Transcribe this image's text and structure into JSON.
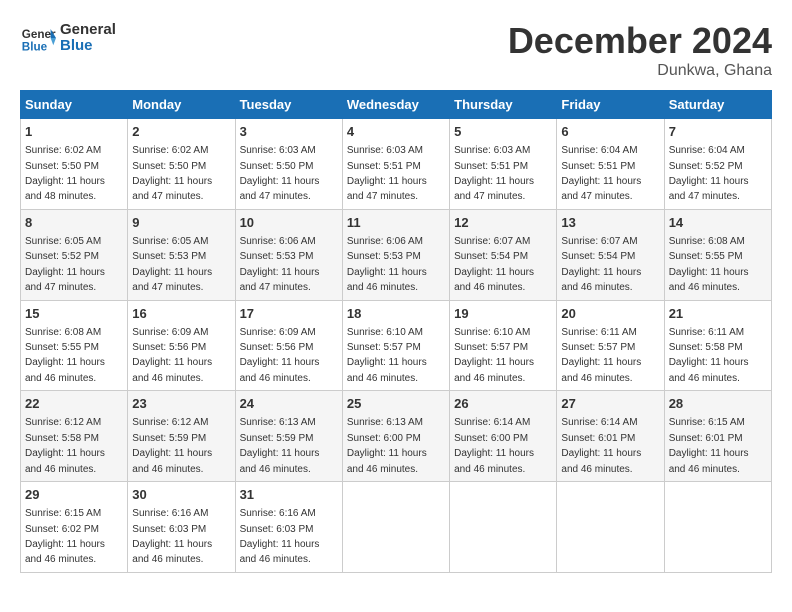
{
  "header": {
    "logo_line1": "General",
    "logo_line2": "Blue",
    "month": "December 2024",
    "location": "Dunkwa, Ghana"
  },
  "days_of_week": [
    "Sunday",
    "Monday",
    "Tuesday",
    "Wednesday",
    "Thursday",
    "Friday",
    "Saturday"
  ],
  "weeks": [
    [
      {
        "day": "1",
        "sunrise": "6:02 AM",
        "sunset": "5:50 PM",
        "daylight": "11 hours and 48 minutes."
      },
      {
        "day": "2",
        "sunrise": "6:02 AM",
        "sunset": "5:50 PM",
        "daylight": "11 hours and 47 minutes."
      },
      {
        "day": "3",
        "sunrise": "6:03 AM",
        "sunset": "5:50 PM",
        "daylight": "11 hours and 47 minutes."
      },
      {
        "day": "4",
        "sunrise": "6:03 AM",
        "sunset": "5:51 PM",
        "daylight": "11 hours and 47 minutes."
      },
      {
        "day": "5",
        "sunrise": "6:03 AM",
        "sunset": "5:51 PM",
        "daylight": "11 hours and 47 minutes."
      },
      {
        "day": "6",
        "sunrise": "6:04 AM",
        "sunset": "5:51 PM",
        "daylight": "11 hours and 47 minutes."
      },
      {
        "day": "7",
        "sunrise": "6:04 AM",
        "sunset": "5:52 PM",
        "daylight": "11 hours and 47 minutes."
      }
    ],
    [
      {
        "day": "8",
        "sunrise": "6:05 AM",
        "sunset": "5:52 PM",
        "daylight": "11 hours and 47 minutes."
      },
      {
        "day": "9",
        "sunrise": "6:05 AM",
        "sunset": "5:53 PM",
        "daylight": "11 hours and 47 minutes."
      },
      {
        "day": "10",
        "sunrise": "6:06 AM",
        "sunset": "5:53 PM",
        "daylight": "11 hours and 47 minutes."
      },
      {
        "day": "11",
        "sunrise": "6:06 AM",
        "sunset": "5:53 PM",
        "daylight": "11 hours and 46 minutes."
      },
      {
        "day": "12",
        "sunrise": "6:07 AM",
        "sunset": "5:54 PM",
        "daylight": "11 hours and 46 minutes."
      },
      {
        "day": "13",
        "sunrise": "6:07 AM",
        "sunset": "5:54 PM",
        "daylight": "11 hours and 46 minutes."
      },
      {
        "day": "14",
        "sunrise": "6:08 AM",
        "sunset": "5:55 PM",
        "daylight": "11 hours and 46 minutes."
      }
    ],
    [
      {
        "day": "15",
        "sunrise": "6:08 AM",
        "sunset": "5:55 PM",
        "daylight": "11 hours and 46 minutes."
      },
      {
        "day": "16",
        "sunrise": "6:09 AM",
        "sunset": "5:56 PM",
        "daylight": "11 hours and 46 minutes."
      },
      {
        "day": "17",
        "sunrise": "6:09 AM",
        "sunset": "5:56 PM",
        "daylight": "11 hours and 46 minutes."
      },
      {
        "day": "18",
        "sunrise": "6:10 AM",
        "sunset": "5:57 PM",
        "daylight": "11 hours and 46 minutes."
      },
      {
        "day": "19",
        "sunrise": "6:10 AM",
        "sunset": "5:57 PM",
        "daylight": "11 hours and 46 minutes."
      },
      {
        "day": "20",
        "sunrise": "6:11 AM",
        "sunset": "5:57 PM",
        "daylight": "11 hours and 46 minutes."
      },
      {
        "day": "21",
        "sunrise": "6:11 AM",
        "sunset": "5:58 PM",
        "daylight": "11 hours and 46 minutes."
      }
    ],
    [
      {
        "day": "22",
        "sunrise": "6:12 AM",
        "sunset": "5:58 PM",
        "daylight": "11 hours and 46 minutes."
      },
      {
        "day": "23",
        "sunrise": "6:12 AM",
        "sunset": "5:59 PM",
        "daylight": "11 hours and 46 minutes."
      },
      {
        "day": "24",
        "sunrise": "6:13 AM",
        "sunset": "5:59 PM",
        "daylight": "11 hours and 46 minutes."
      },
      {
        "day": "25",
        "sunrise": "6:13 AM",
        "sunset": "6:00 PM",
        "daylight": "11 hours and 46 minutes."
      },
      {
        "day": "26",
        "sunrise": "6:14 AM",
        "sunset": "6:00 PM",
        "daylight": "11 hours and 46 minutes."
      },
      {
        "day": "27",
        "sunrise": "6:14 AM",
        "sunset": "6:01 PM",
        "daylight": "11 hours and 46 minutes."
      },
      {
        "day": "28",
        "sunrise": "6:15 AM",
        "sunset": "6:01 PM",
        "daylight": "11 hours and 46 minutes."
      }
    ],
    [
      {
        "day": "29",
        "sunrise": "6:15 AM",
        "sunset": "6:02 PM",
        "daylight": "11 hours and 46 minutes."
      },
      {
        "day": "30",
        "sunrise": "6:16 AM",
        "sunset": "6:03 PM",
        "daylight": "11 hours and 46 minutes."
      },
      {
        "day": "31",
        "sunrise": "6:16 AM",
        "sunset": "6:03 PM",
        "daylight": "11 hours and 46 minutes."
      },
      null,
      null,
      null,
      null
    ]
  ]
}
